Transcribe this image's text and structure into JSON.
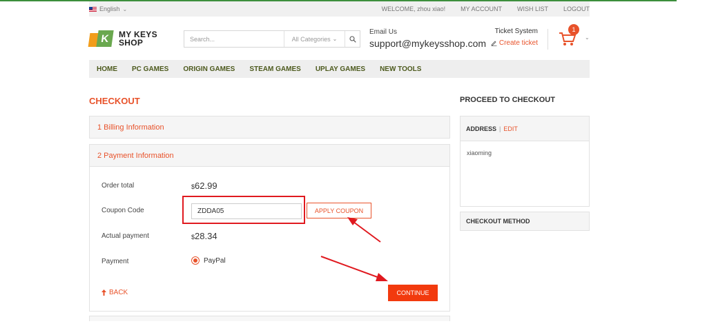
{
  "topbar": {
    "language": "English",
    "welcome": "WELCOME, zhou xiao!",
    "links": [
      "MY ACCOUNT",
      "WISH LIST",
      "LOGOUT"
    ]
  },
  "header": {
    "logo_line1": "MY KEYS",
    "logo_line2": "SHOP",
    "logo_letter": "K",
    "search_placeholder": "Search...",
    "category": "All Categories",
    "email_label": "Email Us",
    "email": "support@mykeysshop.com",
    "ticket_title": "Ticket System",
    "ticket_link": "Create ticket",
    "cart_count": "1"
  },
  "nav": [
    "HOME",
    "PC GAMES",
    "ORIGIN GAMES",
    "STEAM GAMES",
    "UPLAY GAMES",
    "NEW TOOLS"
  ],
  "checkout": {
    "title": "CHECKOUT",
    "step1": "1 Billing Information",
    "step2": "2 Payment Information",
    "order_total_label": "Order total",
    "order_total_currency": "$",
    "order_total_value": "62.99",
    "coupon_label": "Coupon Code",
    "coupon_value": "ZDDA05",
    "apply_coupon": "APPLY COUPON",
    "actual_payment_label": "Actual payment",
    "actual_payment_currency": "$",
    "actual_payment_value": "28.34",
    "payment_label": "Payment",
    "payment_method": "PayPal",
    "back": "BACK",
    "continue": "CONTINUE"
  },
  "sidebar": {
    "title": "PROCEED TO CHECKOUT",
    "address_label": "ADDRESS",
    "edit": "EDIT",
    "address_name": "xiaoming",
    "checkout_method": "CHECKOUT METHOD"
  },
  "colors": {
    "accent": "#e8522a",
    "continue_bg": "#f23a0e",
    "nav_text": "#4d5a1e",
    "annotation_red": "#e0191f"
  }
}
